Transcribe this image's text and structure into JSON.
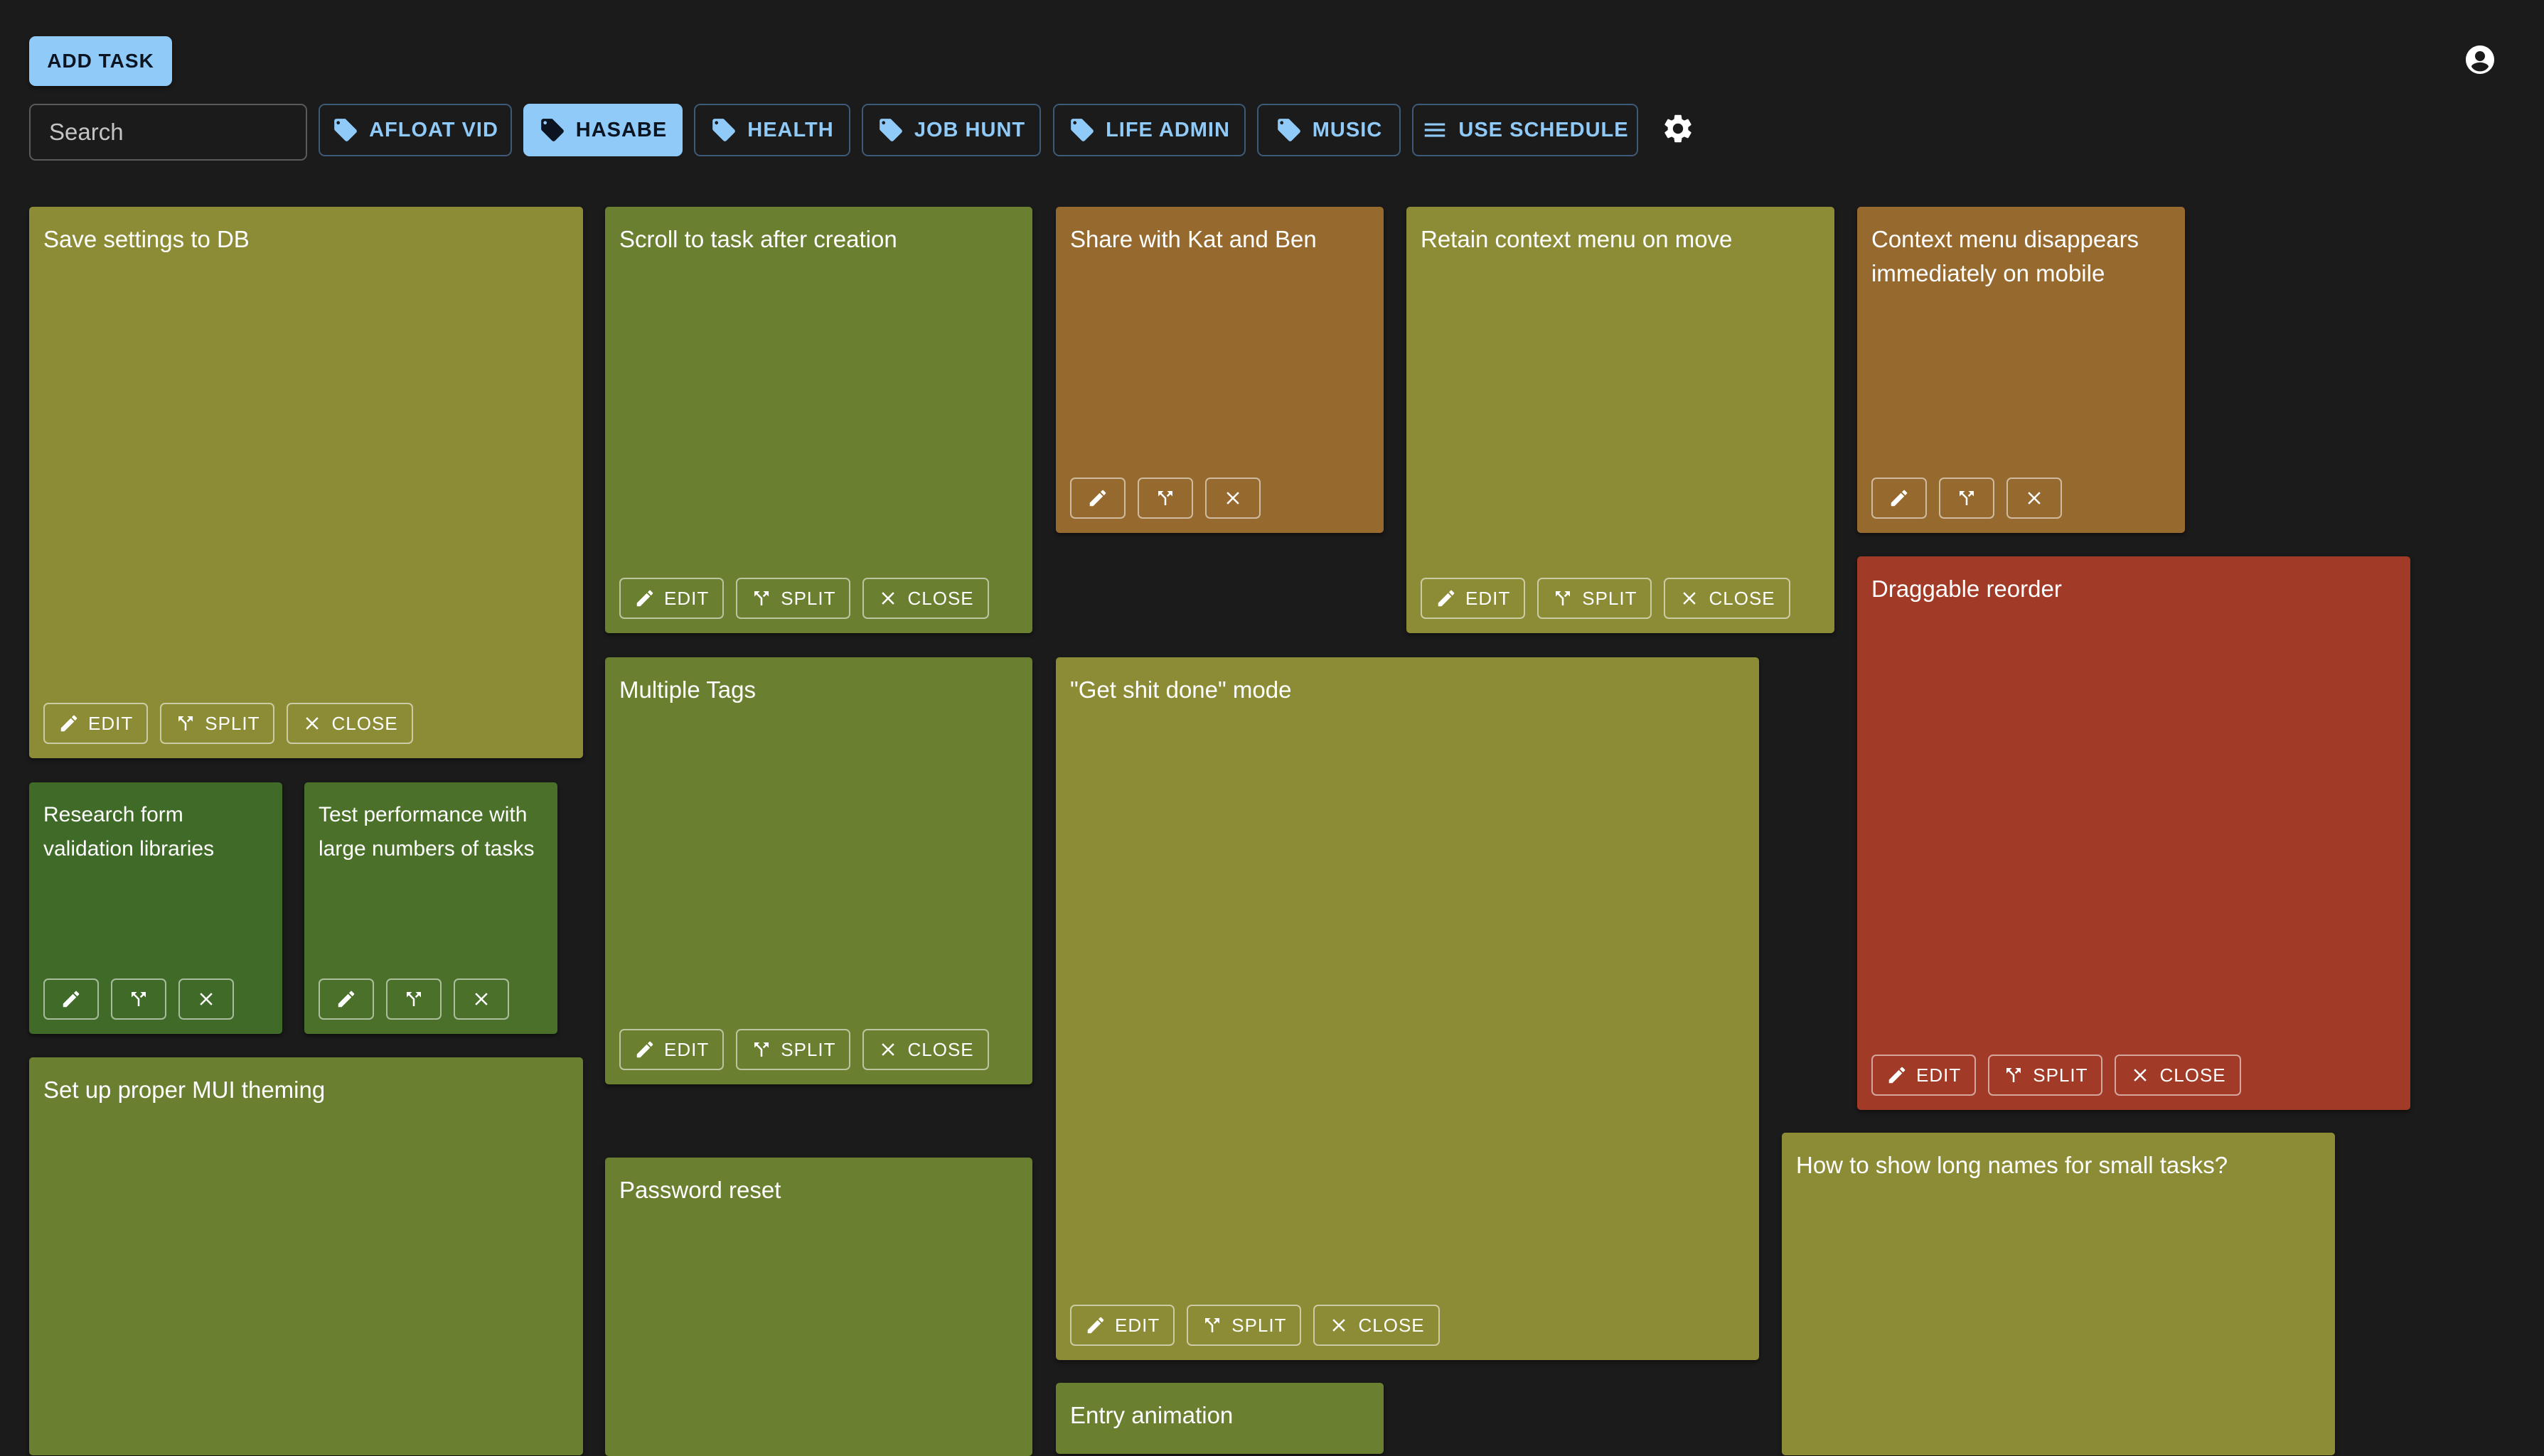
{
  "header": {
    "add_task_label": "ADD TASK",
    "search_placeholder": "Search",
    "settings_icon": "gear-icon",
    "account_icon": "account-circle-icon"
  },
  "tags": [
    {
      "label": "AFLOAT VID",
      "icon": "tag-icon",
      "active": false
    },
    {
      "label": "HASABE",
      "icon": "tag-icon",
      "active": true
    },
    {
      "label": "HEALTH",
      "icon": "tag-icon",
      "active": false
    },
    {
      "label": "JOB HUNT",
      "icon": "tag-icon",
      "active": false
    },
    {
      "label": "LIFE ADMIN",
      "icon": "tag-icon",
      "active": false
    },
    {
      "label": "MUSIC",
      "icon": "tag-icon",
      "active": false
    },
    {
      "label": "USE SCHEDULE",
      "icon": "menu-icon",
      "active": false
    }
  ],
  "actions": {
    "edit": "EDIT",
    "split": "SPLIT",
    "close": "CLOSE"
  },
  "colors": {
    "olive": "#8d8c36",
    "green": "#6a7f2f",
    "dark_green": "#3f6a28",
    "mid_green": "#4a7029",
    "orange": "#966a2e",
    "red": "#a13b28",
    "accent": "#90caf9",
    "background": "#1b1b1b"
  },
  "tasks": [
    {
      "title": "Save settings to DB",
      "color": "olive"
    },
    {
      "title": "Scroll to task after creation",
      "color": "green"
    },
    {
      "title": "Share with Kat and Ben",
      "color": "orange"
    },
    {
      "title": "Retain context menu on move",
      "color": "olive"
    },
    {
      "title": "Context menu disappears immediately on mobile",
      "color": "orange"
    },
    {
      "title": "Draggable reorder",
      "color": "red"
    },
    {
      "title": "Research form validation libraries",
      "color": "dark_green"
    },
    {
      "title": "Test performance with large numbers of tasks",
      "color": "mid_green"
    },
    {
      "title": "Multiple Tags",
      "color": "green"
    },
    {
      "title": "\"Get shit done\" mode",
      "color": "olive"
    },
    {
      "title": "Set up proper MUI theming",
      "color": "green"
    },
    {
      "title": "Password reset",
      "color": "green"
    },
    {
      "title": "How to show long names for small tasks?",
      "color": "olive"
    },
    {
      "title": "Entry animation",
      "color": "green"
    }
  ]
}
